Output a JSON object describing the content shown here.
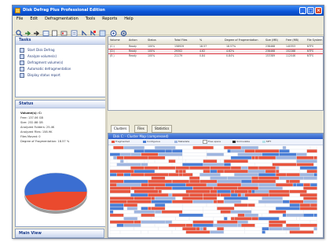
{
  "window": {
    "title": "Disk Defrag Plus Professional Edition",
    "controls": [
      "_",
      "□",
      "×"
    ]
  },
  "menu": [
    "File",
    "Edit",
    "Defragmentation",
    "Tools",
    "Reports",
    "Help"
  ],
  "toolbar_icons": [
    "analyze-icon",
    "defrag-icon",
    "stop-icon",
    "schedule-icon",
    "properties-icon",
    "settings-icon",
    "report-icon",
    "list-icon",
    "chart-icon",
    "help-icon",
    "about-icon"
  ],
  "tasks": {
    "title": "Tasks",
    "items": [
      "Start Disk Defrag",
      "Analyze volume(s)",
      "Defragment volume(s)",
      "Automatic defragmentation",
      "Display status report"
    ]
  },
  "status": {
    "title": "Status",
    "volume": "Volume(s): C:",
    "lines": [
      "Free: 137.06 GB",
      "Size: 232.88 GB",
      "Analyzed Folders: 25.4K",
      "Analyzed Files: 158.9K",
      "Files Moved: 0",
      "Degree of Fragmentation: 18.57 %"
    ]
  },
  "main_view": {
    "title": "Main View"
  },
  "volume_list": {
    "columns": [
      "Volume",
      "Action",
      "Status",
      "Total Files",
      "%",
      "Degree of Fragmentation",
      "Size (MB)",
      "Free (MB)",
      "File System"
    ],
    "rows": [
      [
        "(C:)",
        "Ready",
        "100%",
        "158929",
        "18.57",
        "18.57%",
        "238468",
        "140353",
        "NTFS"
      ],
      [
        "(D:)",
        "Ready",
        "100%",
        "29302",
        "4.62",
        "4.62%",
        "238468",
        "152288",
        "NTFS"
      ],
      [
        "(E:)",
        "Ready",
        "100%",
        "21179",
        "0.84",
        "0.84%",
        "153389",
        "112046",
        "NTFS"
      ]
    ],
    "selected_row": 1
  },
  "cluster_tabs": [
    "Clusters",
    "Files",
    "Statistics"
  ],
  "cluster_map": {
    "title": "Disk C: - Cluster Map (compressed)",
    "legend": [
      {
        "label": "Fragmented",
        "color": "#e8553e"
      },
      {
        "label": "Contiguous",
        "color": "#4a7fd6"
      },
      {
        "label": "Metadata",
        "color": "#9fb6e0"
      },
      {
        "label": "Free space",
        "color": "#ffffff"
      },
      {
        "label": "Unmovable",
        "color": "#2c2c2c"
      },
      {
        "label": "MFT",
        "color": "#b5e2e8"
      }
    ]
  },
  "colors": {
    "fragmented": "#e8553e",
    "contiguous": "#4a7fd6",
    "metadata": "#9fb6e0",
    "free": "#ffffff",
    "selection_outline": "#d9323d",
    "pie_free": "#3b6ed1",
    "pie_used": "#ea4a2e"
  }
}
